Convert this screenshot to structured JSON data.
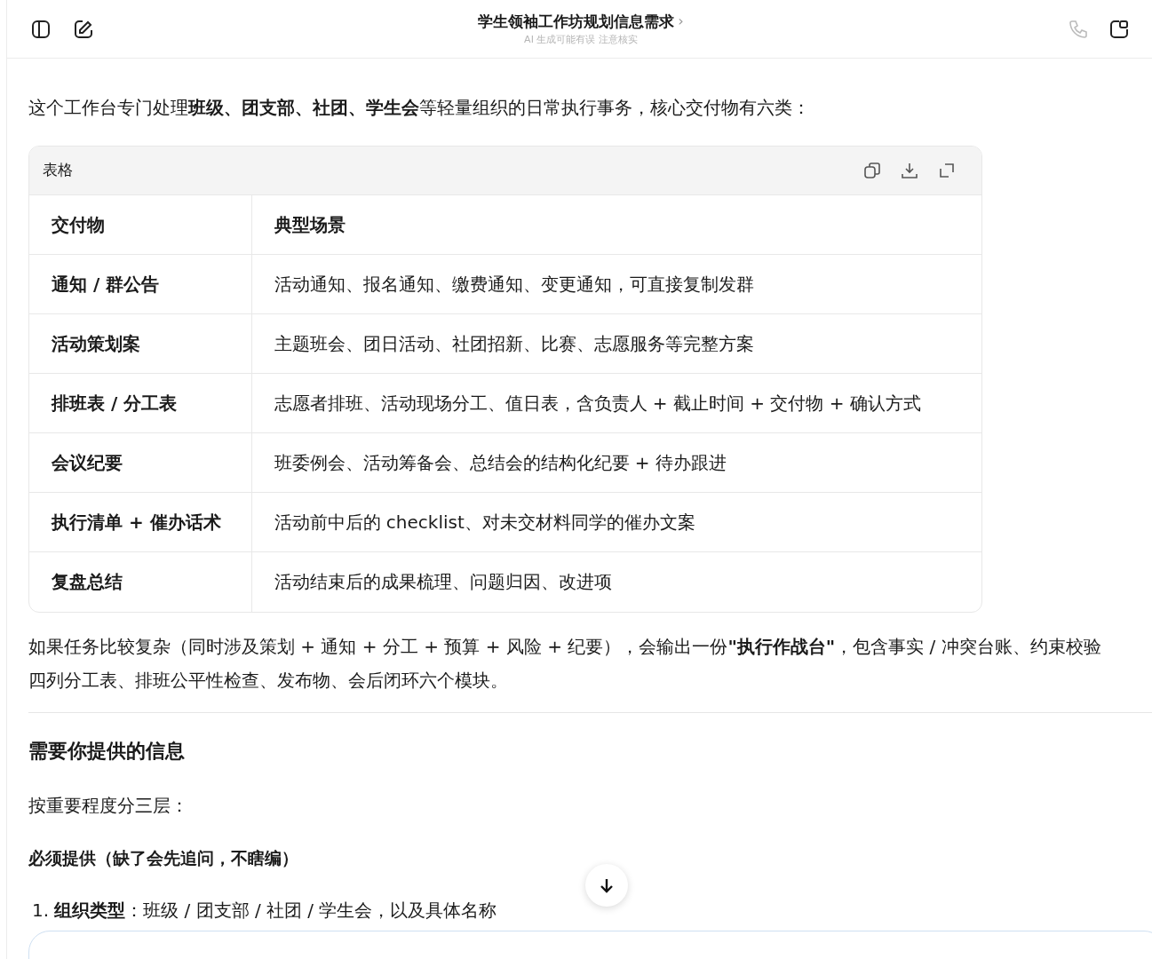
{
  "header": {
    "title": "学生领袖工作坊规划信息需求",
    "chevron": "›",
    "subtitle": "AI 生成可能有误 注意核实"
  },
  "intro": "这个工作台专门处理**班级、团支部、社团、学生会**等轻量组织的日常执行事务，核心交付物有六类：",
  "table": {
    "label": "表格",
    "columns": [
      "交付物",
      "典型场景"
    ],
    "rows": [
      [
        "通知 / 群公告",
        "活动通知、报名通知、缴费通知、变更通知，可直接复制发群"
      ],
      [
        "活动策划案",
        "主题班会、团日活动、社团招新、比赛、志愿服务等完整方案"
      ],
      [
        "排班表 / 分工表",
        "志愿者排班、活动现场分工、值日表，含负责人 + 截止时间 + 交付物 + 确认方式"
      ],
      [
        "会议纪要",
        "班委例会、活动筹备会、总结会的结构化纪要 + 待办跟进"
      ],
      [
        "执行清单 + 催办话术",
        "活动前中后的 checklist、对未交材料同学的催办文案"
      ],
      [
        "复盘总结",
        "活动结束后的成果梳理、问题归因、改进项"
      ]
    ]
  },
  "paragraph_lines": [
    "如果任务比较复杂（同时涉及策划 + 通知 + 分工 + 预算 + 风险 + 纪要），会输出一份**\"执行作战台\"**，包含事实 / 冲突台账、约束校验",
    "四列分工表、排班公平性检查、发布物、会后闭环六个模块。"
  ],
  "section_heading": "需要你提供的信息",
  "section_intro": "按重要程度分三层：",
  "subheading": "必须提供（缺了会先追问，不瞎编）",
  "list": [
    {
      "marker": "1.",
      "text": "**组织类型**：班级 / 团支部 / 社团 / 学生会，以及具体名称"
    }
  ]
}
